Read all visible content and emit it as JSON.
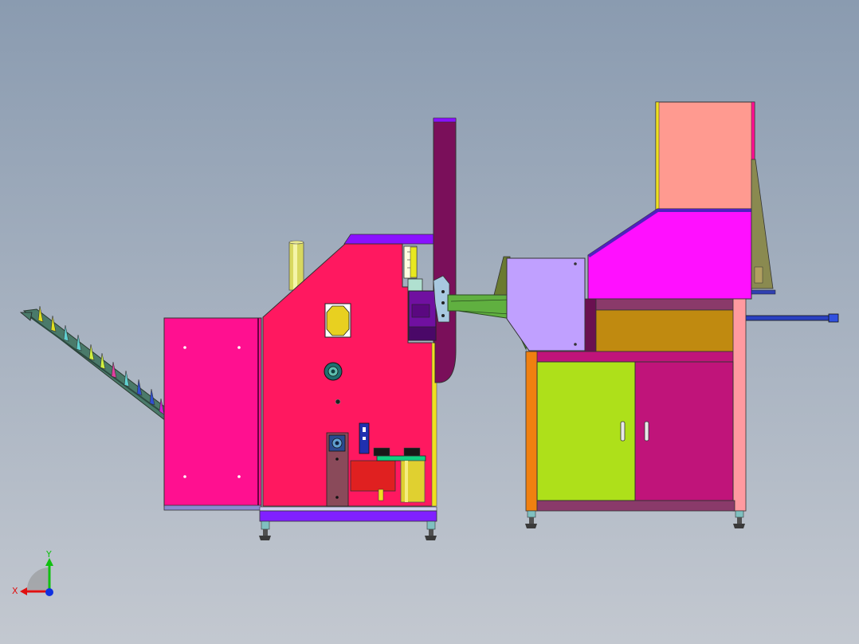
{
  "view": {
    "background_top": "#8a9bb0",
    "background_bottom": "#c3c8d0"
  },
  "triad": {
    "x_label": "X",
    "y_label": "Y",
    "x_color": "#e01010",
    "y_color": "#10c010",
    "z_color": "#1030e0"
  },
  "palette": {
    "left_cabinet": "#ff1090",
    "main_panel": "#ff1860",
    "chute": "#7a0f5a",
    "hopper": "#ff9a90",
    "hopper_body": "#ff10ff",
    "door_left": "#aee01a",
    "door_right": "#c0147a",
    "feed_box": "#c0a0ff",
    "drawer": "#c08a10",
    "conveyor": "#4a7a6a",
    "base_rail": "#8020ff"
  }
}
